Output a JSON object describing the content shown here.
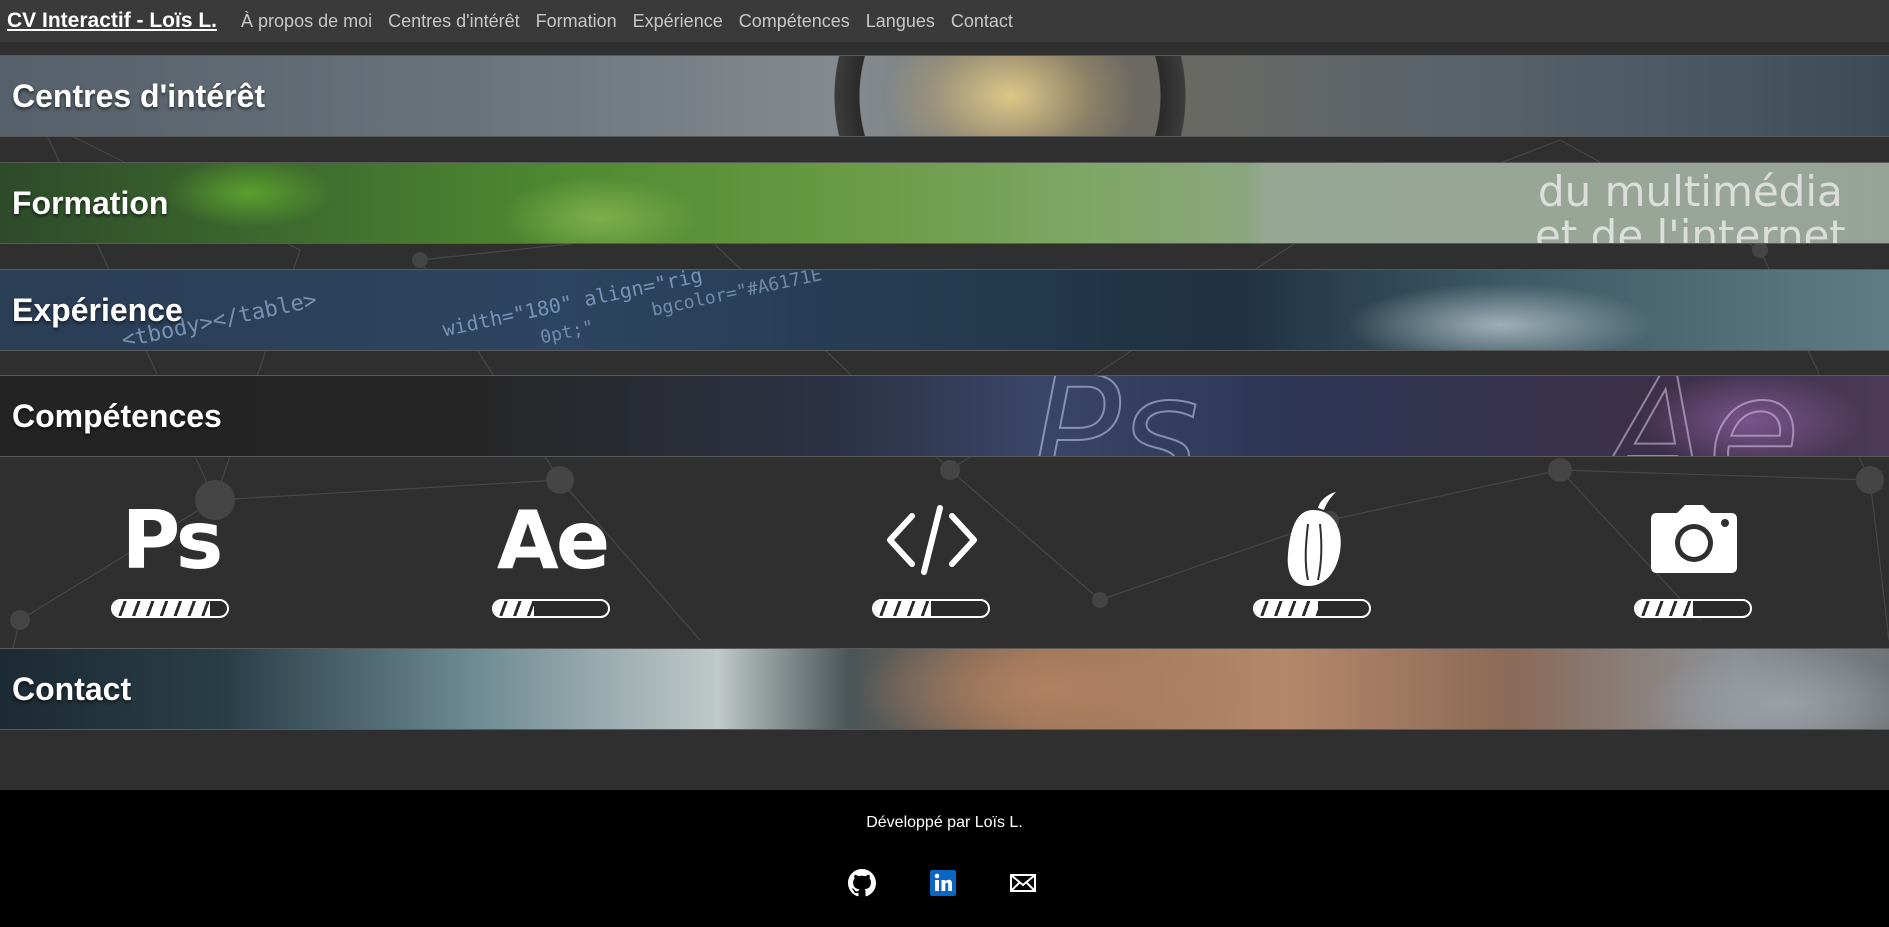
{
  "nav": {
    "brand": "CV Interactif - Loïs L.",
    "items": [
      "À propos de moi",
      "Centres d'intérêt",
      "Formation",
      "Expérience",
      "Compétences",
      "Langues",
      "Contact"
    ]
  },
  "sections": {
    "interets": "Centres d'intérêt",
    "formation": "Formation",
    "experience": "Expérience",
    "competences": "Compétences",
    "contact": "Contact"
  },
  "banner_text": {
    "formation_line1": "du multimédia",
    "formation_line2": "et de l'internet",
    "experience_code1": "<tbody></table>",
    "experience_code2": "width=\"180\" align=\"rig",
    "experience_code3": "bgcolor=\"#A6171E",
    "experience_code4": "0pt;\"",
    "competences_ps": "Ps",
    "competences_ae": "Ae"
  },
  "skills": [
    {
      "name": "photoshop-icon",
      "label": "Ps",
      "level": 0.85
    },
    {
      "name": "after-effects-icon",
      "label": "Ae",
      "level": 0.35
    },
    {
      "name": "code-icon",
      "label": "",
      "level": 0.5
    },
    {
      "name": "fl-studio-icon",
      "label": "",
      "level": 0.55
    },
    {
      "name": "camera-icon",
      "label": "",
      "level": 0.5
    }
  ],
  "footer": {
    "text": "Développé par Loïs L.",
    "links": [
      "github-icon",
      "linkedin-icon",
      "email-icon"
    ]
  },
  "colors": {
    "nav_bg": "#3a3a3a",
    "page_bg": "#2f2f2f",
    "footer_bg": "#000000",
    "linkedin": "#0a66c2"
  }
}
